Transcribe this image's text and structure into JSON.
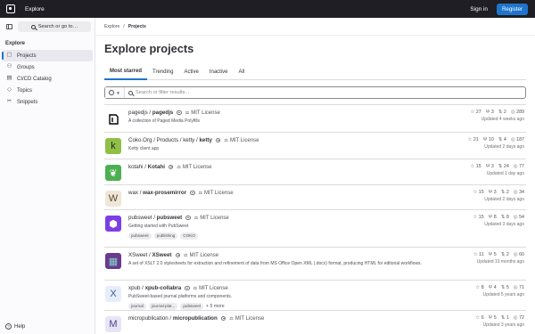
{
  "topbar": {
    "title": "Explore",
    "signin": "Sign in",
    "register": "Register"
  },
  "sidebar": {
    "search_label": "Search or go to…",
    "section": "Explore",
    "items": [
      {
        "label": "Projects",
        "icon": "project-icon",
        "glyph": "▢"
      },
      {
        "label": "Groups",
        "icon": "group-icon",
        "glyph": "⚇"
      },
      {
        "label": "CI/CD Catalog",
        "icon": "catalog-icon",
        "glyph": "▤"
      },
      {
        "label": "Topics",
        "icon": "label-icon",
        "glyph": "◇"
      },
      {
        "label": "Snippets",
        "icon": "snippet-icon",
        "glyph": "✂"
      }
    ],
    "help": "Help"
  },
  "breadcrumb": {
    "root": "Explore",
    "sep": "/",
    "current": "Projects"
  },
  "page_title": "Explore projects",
  "tabs": [
    "Most starred",
    "Trending",
    "Active",
    "Inactive",
    "All"
  ],
  "filter": {
    "placeholder": "Search or filter results..."
  },
  "license_label": "MIT License",
  "scale_glyph": "⚖",
  "colors": {
    "accent": "#1f75cb",
    "topbar": "#1f1e24"
  },
  "projects": [
    {
      "ns": "pagedjs / ",
      "name": "pagedjs",
      "desc": "A collection of Paged Media Polyfills",
      "stars": "27",
      "forks": "3",
      "mrs": "2",
      "issues": "289",
      "updated": "Updated 4 weeks ago",
      "tags": [],
      "more": "",
      "avatar": {
        "bg": "#ffffff",
        "letter": "",
        "fg": "#000"
      }
    },
    {
      "ns": "Coko.Org / Products / ketty / ",
      "name": "ketty",
      "desc": "Ketty client app",
      "stars": "21",
      "forks": "10",
      "mrs": "4",
      "issues": "187",
      "updated": "Updated 2 days ago",
      "tags": [],
      "more": "",
      "avatar": {
        "bg": "#8fbf47",
        "letter": "k",
        "fg": "#2d2a25"
      }
    },
    {
      "ns": "kotahi / ",
      "name": "Kotahi",
      "desc": "",
      "stars": "15",
      "forks": "3",
      "mrs": "24",
      "issues": "77",
      "updated": "Updated 1 day ago",
      "tags": [],
      "more": "",
      "avatar": {
        "bg": "#4caf50",
        "letter": "❦",
        "fg": "#ffffff"
      }
    },
    {
      "ns": "wax / ",
      "name": "wax-prosemirror",
      "desc": "",
      "stars": "15",
      "forks": "3",
      "mrs": "2",
      "issues": "34",
      "updated": "Updated 2 days ago",
      "tags": [],
      "more": "",
      "avatar": {
        "bg": "#f0e6d8",
        "letter": "W",
        "fg": "#5a4a3a"
      }
    },
    {
      "ns": "pubsweet / ",
      "name": "pubsweet",
      "desc": "Getting started with PubSweet",
      "stars": "15",
      "forks": "8",
      "mrs": "8",
      "issues": "54",
      "updated": "Updated 3 days ago",
      "tags": [
        "pubsweet",
        "publishing",
        "COKO"
      ],
      "more": "",
      "avatar": {
        "bg": "#7b3fe4",
        "letter": "⬢",
        "fg": "#ffffff"
      }
    },
    {
      "ns": "XSweet / ",
      "name": "XSweet",
      "desc": "A set of XSLT 2.0 stylesheets for extraction and refinement of data from MS Office Open XML (.docx) format, producing HTML for editorial workflows.",
      "stars": "11",
      "forks": "5",
      "mrs": "2",
      "issues": "60",
      "updated": "Updated 10 months ago",
      "tags": [],
      "more": "",
      "avatar": {
        "bg": "#6b3a8f",
        "letter": "▦",
        "fg": "#7fd4c8"
      }
    },
    {
      "ns": "xpub / ",
      "name": "xpub-collabra",
      "desc": "PubSweet-based journal platforms and components.",
      "stars": "8",
      "forks": "4",
      "mrs": "5",
      "issues": "71",
      "updated": "Updated 5 years ago",
      "tags": [
        "journal",
        "journal-plat...",
        "pubsweet"
      ],
      "more": "+ 5 more",
      "avatar": {
        "bg": "#e7eefb",
        "letter": "X",
        "fg": "#3b5998"
      }
    },
    {
      "ns": "micropublication / ",
      "name": "micropublication",
      "desc": "",
      "stars": "6",
      "forks": "5",
      "mrs": "1",
      "issues": "72",
      "updated": "Updated 3 years ago",
      "tags": [],
      "more": "",
      "avatar": {
        "bg": "#e8e4f6",
        "letter": "M",
        "fg": "#4b3f8f"
      }
    }
  ]
}
